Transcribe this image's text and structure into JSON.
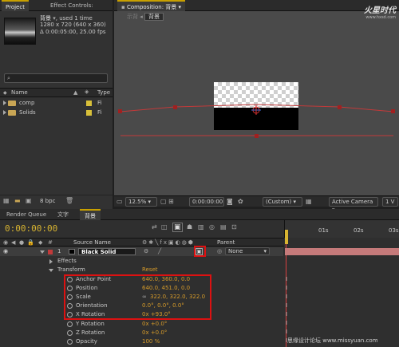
{
  "project_panel": {
    "tabs": [
      "Project",
      "Effect Controls:"
    ],
    "footage": {
      "name": "背景",
      "used": ", used 1 time",
      "dimensions": "1280 x 720  (640 x 360)",
      "info": "Δ 0:00:05:00, 25.00 fps"
    },
    "search_placeholder": "",
    "columns": [
      "Name",
      "Type"
    ],
    "items": [
      {
        "name": "comp",
        "type": "Fi"
      },
      {
        "name": "Solids",
        "type": "Fi"
      }
    ],
    "bpc_label": "8 bpc"
  },
  "composition": {
    "tab_label": "Composition: 背景",
    "breadcrumb_prev": "示背",
    "breadcrumb_current": "背景",
    "zoom": "12.5%",
    "timecode": "0:00:00:00",
    "resolution": "(Custom)",
    "camera": "Active Camera",
    "views": "1 V"
  },
  "watermark": {
    "brand": "火星时代",
    "url": "www.hxsd.com"
  },
  "timeline": {
    "tabs": [
      "Render Queue",
      "文字",
      "背景"
    ],
    "current_time": "0:00:00:00",
    "columns": {
      "source_name": "Source Name",
      "parent": "Parent"
    },
    "ruler_marks": [
      "01s",
      "02s",
      "03s"
    ],
    "layer": {
      "index": "1",
      "name": "Black Solid",
      "parent": "None"
    },
    "effects_label": "Effects",
    "transform_label": "Transform",
    "reset_label": "Reset",
    "properties": [
      {
        "name": "Anchor Point",
        "value": "640.0, 360.0, 0.0"
      },
      {
        "name": "Position",
        "value": "640.0, 451.0, 0.0"
      },
      {
        "name": "Scale",
        "value": "322.0, 322.0, 322.0"
      },
      {
        "name": "Orientation",
        "value": "0.0°, 0.0°, 0.0°"
      },
      {
        "name": "X Rotation",
        "value": "0x +93.0°"
      },
      {
        "name": "Y Rotation",
        "value": "0x +0.0°"
      },
      {
        "name": "Z Rotation",
        "value": "0x +0.0°"
      },
      {
        "name": "Opacity",
        "value": "100 %"
      }
    ]
  },
  "bottom_watermark": "思缘设计论坛  www.missyuan.com",
  "colors": {
    "accent": "#d69b2a",
    "timecode": "#d8b431",
    "highlight_box": "#dd1111",
    "layer_bar": "#c67b7b"
  }
}
